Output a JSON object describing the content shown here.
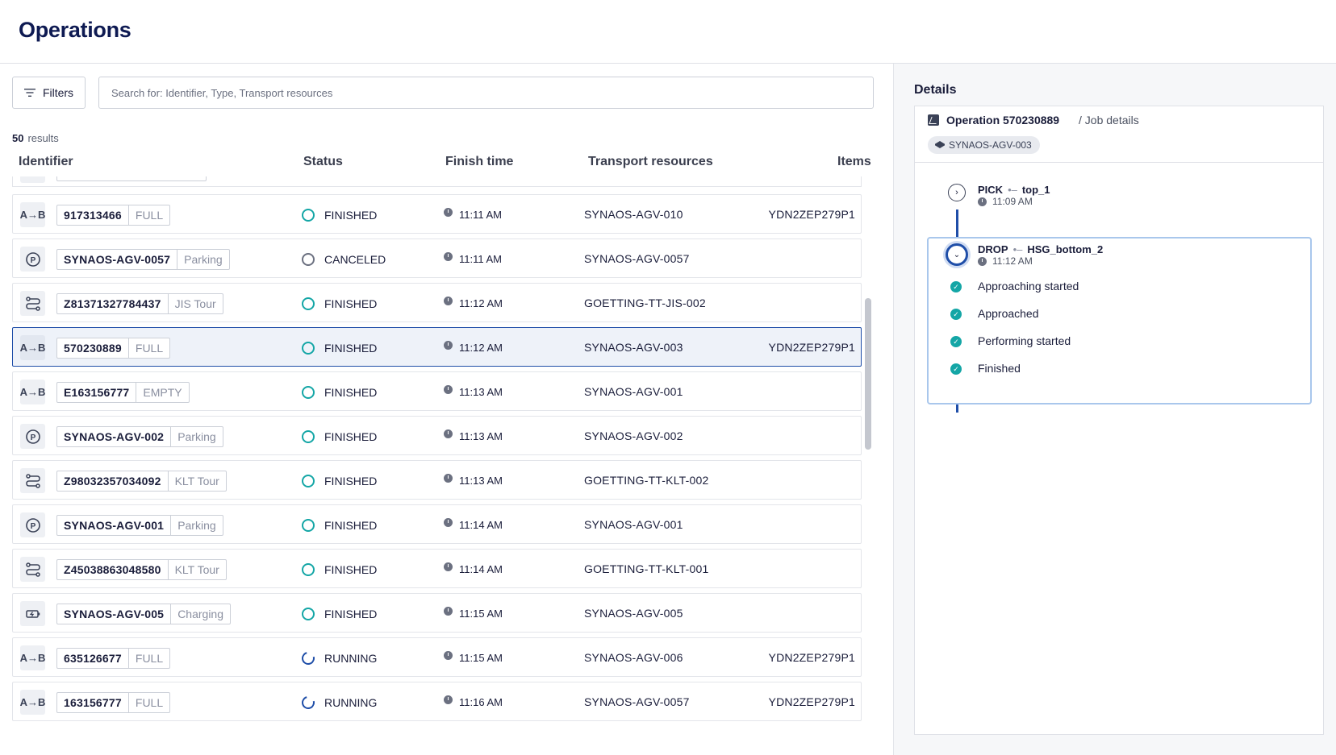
{
  "header": {
    "title": "Operations"
  },
  "toolbar": {
    "filters_label": "Filters",
    "search_placeholder": "Search for: Identifier, Type, Transport resources"
  },
  "results": {
    "count": "50",
    "label": "results"
  },
  "table": {
    "columns": {
      "identifier": "Identifier",
      "status": "Status",
      "finish_time": "Finish time",
      "transport": "Transport resources",
      "items": "Items"
    },
    "rows": [
      {
        "type": "ab",
        "id": "917313466",
        "tag": "FULL",
        "status": "FINISHED",
        "status_kind": "finished",
        "time": "11:11 AM",
        "transport": "SYNAOS-AGV-010",
        "items": "YDN2ZEP279P1"
      },
      {
        "type": "parking",
        "id": "SYNAOS-AGV-0057",
        "tag": "Parking",
        "status": "CANCELED",
        "status_kind": "canceled",
        "time": "11:11 AM",
        "transport": "SYNAOS-AGV-0057",
        "items": ""
      },
      {
        "type": "tour",
        "id": "Z81371327784437",
        "tag": "JIS Tour",
        "status": "FINISHED",
        "status_kind": "finished",
        "time": "11:12 AM",
        "transport": "GOETTING-TT-JIS-002",
        "items": ""
      },
      {
        "type": "ab",
        "id": "570230889",
        "tag": "FULL",
        "status": "FINISHED",
        "status_kind": "finished",
        "time": "11:12 AM",
        "transport": "SYNAOS-AGV-003",
        "items": "YDN2ZEP279P1",
        "selected": true
      },
      {
        "type": "ab",
        "id": "E163156777",
        "tag": "EMPTY",
        "status": "FINISHED",
        "status_kind": "finished",
        "time": "11:13 AM",
        "transport": "SYNAOS-AGV-001",
        "items": ""
      },
      {
        "type": "parking",
        "id": "SYNAOS-AGV-002",
        "tag": "Parking",
        "status": "FINISHED",
        "status_kind": "finished",
        "time": "11:13 AM",
        "transport": "SYNAOS-AGV-002",
        "items": ""
      },
      {
        "type": "tour",
        "id": "Z98032357034092",
        "tag": "KLT Tour",
        "status": "FINISHED",
        "status_kind": "finished",
        "time": "11:13 AM",
        "transport": "GOETTING-TT-KLT-002",
        "items": ""
      },
      {
        "type": "parking",
        "id": "SYNAOS-AGV-001",
        "tag": "Parking",
        "status": "FINISHED",
        "status_kind": "finished",
        "time": "11:14 AM",
        "transport": "SYNAOS-AGV-001",
        "items": ""
      },
      {
        "type": "tour",
        "id": "Z45038863048580",
        "tag": "KLT Tour",
        "status": "FINISHED",
        "status_kind": "finished",
        "time": "11:14 AM",
        "transport": "GOETTING-TT-KLT-001",
        "items": ""
      },
      {
        "type": "charging",
        "id": "SYNAOS-AGV-005",
        "tag": "Charging",
        "status": "FINISHED",
        "status_kind": "finished",
        "time": "11:15 AM",
        "transport": "SYNAOS-AGV-005",
        "items": ""
      },
      {
        "type": "ab",
        "id": "635126677",
        "tag": "FULL",
        "status": "RUNNING",
        "status_kind": "running",
        "time": "11:15 AM",
        "transport": "SYNAOS-AGV-006",
        "items": "YDN2ZEP279P1"
      },
      {
        "type": "ab",
        "id": "163156777",
        "tag": "FULL",
        "status": "RUNNING",
        "status_kind": "running",
        "time": "11:16 AM",
        "transport": "SYNAOS-AGV-0057",
        "items": "YDN2ZEP279P1"
      }
    ]
  },
  "details": {
    "label": "Details",
    "operation_title": "Operation 570230889",
    "operation_sub": "/ Job details",
    "agv": "SYNAOS-AGV-003",
    "pick": {
      "action": "PICK",
      "location": "top_1",
      "time": "11:09 AM"
    },
    "drop": {
      "action": "DROP",
      "location": "HSG_bottom_2",
      "time": "11:12 AM"
    },
    "substeps": [
      "Approaching started",
      "Approached",
      "Performing started",
      "Finished"
    ]
  },
  "colors": {
    "accent": "#1f4ea8",
    "finished": "#14a6a6",
    "canceled": "#6b7080"
  }
}
